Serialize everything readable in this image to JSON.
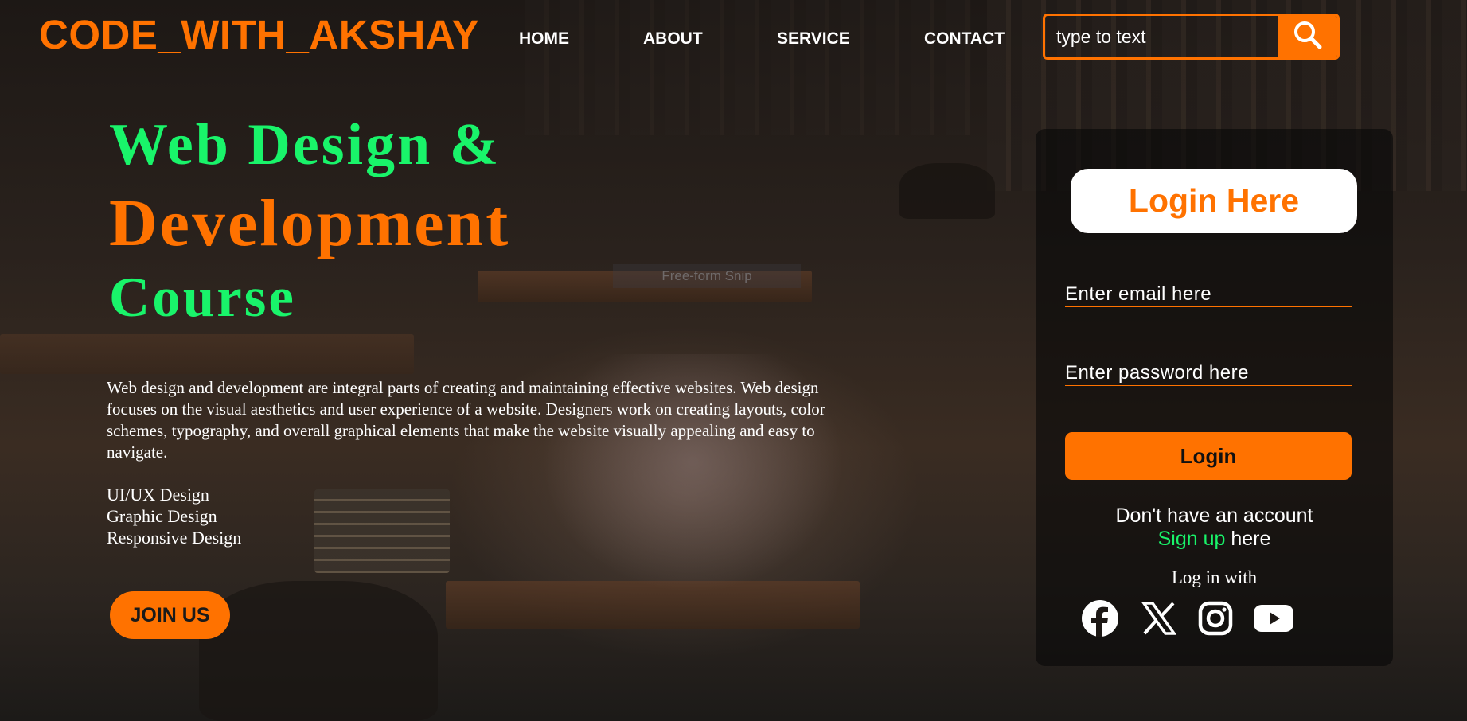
{
  "header": {
    "brand": "CODE_WITH_AKSHAY",
    "nav": [
      "HOME",
      "ABOUT",
      "SERVICE",
      "CONTACT"
    ],
    "search_placeholder": "type to text"
  },
  "hero": {
    "line1": "Web Design &",
    "line2": "Development",
    "line3": "Course",
    "paragraph": "Web design and development are integral parts of creating and maintaining effective websites. Web design focuses on the visual aesthetics and user experience of a website. Designers work on creating layouts, color schemes, typography, and overall graphical elements that make the website visually appealing and easy to navigate.",
    "services": [
      "UI/UX Design",
      "Graphic Design",
      "Responsive Design"
    ],
    "join_label": "JOIN US"
  },
  "login": {
    "title": "Login Here",
    "email_placeholder": "Enter email here",
    "password_placeholder": "Enter password here",
    "button_label": "Login",
    "no_account": "Don't have an account",
    "signup_link": "Sign up",
    "signup_suffix": " here",
    "login_with": "Log in with",
    "social_icons": [
      "facebook-icon",
      "x-icon",
      "instagram-icon",
      "youtube-icon"
    ]
  },
  "overlay": {
    "snip_label": "Free-form Snip"
  },
  "colors": {
    "accent": "#ff7200",
    "green": "#19f46a",
    "text": "#ffffff"
  }
}
